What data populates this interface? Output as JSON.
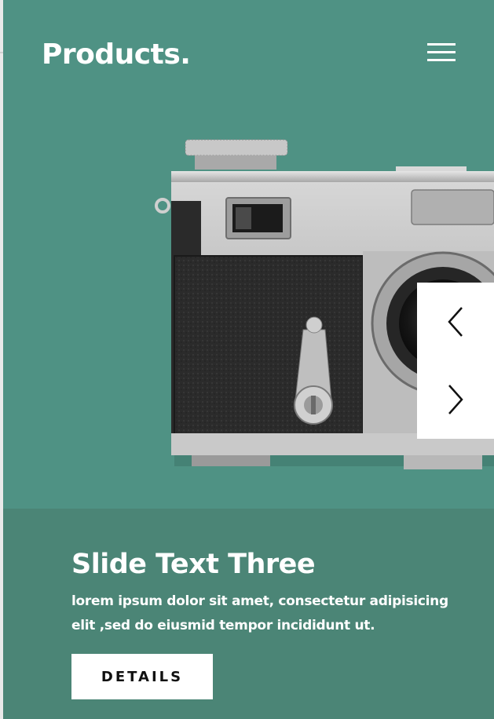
{
  "header": {
    "brand": "Products.",
    "menu_icon": "hamburger-menu-icon"
  },
  "slider": {
    "image_subject": "camera-photo",
    "prev_icon": "chevron-left-icon",
    "next_icon": "chevron-right-icon"
  },
  "caption": {
    "title": "Slide Text Three",
    "text_line1": "lorem ipsum dolor sit amet, consectetur adipisicing",
    "text_line2": "elit ,sed do eiusmid tempor incididunt ut.",
    "button_label": "DETAILS"
  },
  "colors": {
    "hero_background": "#4f9284",
    "caption_background": "#4b8576",
    "text": "#ffffff",
    "button_background": "#ffffff",
    "button_text": "#111111"
  }
}
